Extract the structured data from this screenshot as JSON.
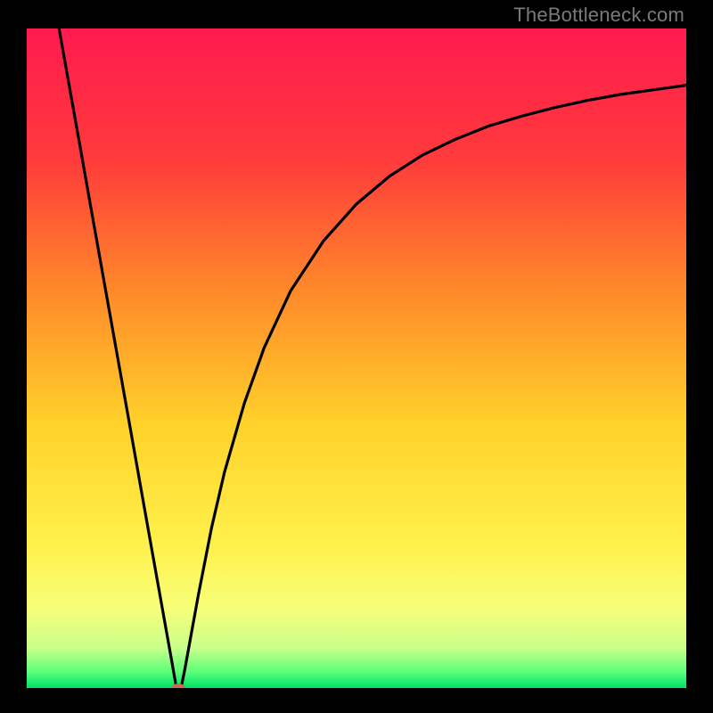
{
  "attribution": "TheBottleneck.com",
  "chart_data": {
    "type": "line",
    "title": "",
    "xlabel": "",
    "ylabel": "",
    "xlim": [
      0,
      100
    ],
    "ylim": [
      0,
      100
    ],
    "gradient_stops": [
      {
        "offset": 0.0,
        "color": "#ff1a4f"
      },
      {
        "offset": 0.2,
        "color": "#ff3b3b"
      },
      {
        "offset": 0.4,
        "color": "#ff8a2a"
      },
      {
        "offset": 0.6,
        "color": "#ffd22a"
      },
      {
        "offset": 0.78,
        "color": "#fff04a"
      },
      {
        "offset": 0.88,
        "color": "#f7ff7a"
      },
      {
        "offset": 0.94,
        "color": "#c8ff8a"
      },
      {
        "offset": 0.975,
        "color": "#5dff7a"
      },
      {
        "offset": 1.0,
        "color": "#00e06a"
      }
    ],
    "series": [
      {
        "name": "bottleneck-curve",
        "points": [
          {
            "x": 4.9,
            "y": 100.0
          },
          {
            "x": 6.0,
            "y": 93.8
          },
          {
            "x": 8.0,
            "y": 82.6
          },
          {
            "x": 10.0,
            "y": 71.3
          },
          {
            "x": 12.0,
            "y": 60.1
          },
          {
            "x": 14.0,
            "y": 48.9
          },
          {
            "x": 16.0,
            "y": 37.7
          },
          {
            "x": 18.0,
            "y": 26.4
          },
          {
            "x": 20.0,
            "y": 15.2
          },
          {
            "x": 22.0,
            "y": 4.0
          },
          {
            "x": 22.7,
            "y": 0.0
          },
          {
            "x": 23.4,
            "y": 0.0
          },
          {
            "x": 24.0,
            "y": 3.0
          },
          {
            "x": 25.0,
            "y": 8.5
          },
          {
            "x": 26.0,
            "y": 14.0
          },
          {
            "x": 28.0,
            "y": 24.2
          },
          {
            "x": 30.0,
            "y": 32.8
          },
          {
            "x": 33.0,
            "y": 43.2
          },
          {
            "x": 36.0,
            "y": 51.6
          },
          {
            "x": 40.0,
            "y": 60.2
          },
          {
            "x": 45.0,
            "y": 67.8
          },
          {
            "x": 50.0,
            "y": 73.4
          },
          {
            "x": 55.0,
            "y": 77.6
          },
          {
            "x": 60.0,
            "y": 80.8
          },
          {
            "x": 65.0,
            "y": 83.2
          },
          {
            "x": 70.0,
            "y": 85.2
          },
          {
            "x": 75.0,
            "y": 86.7
          },
          {
            "x": 80.0,
            "y": 88.0
          },
          {
            "x": 85.0,
            "y": 89.1
          },
          {
            "x": 90.0,
            "y": 90.0
          },
          {
            "x": 95.0,
            "y": 90.7
          },
          {
            "x": 100.0,
            "y": 91.4
          }
        ]
      }
    ],
    "marker": {
      "x": 23.0,
      "y": 0.0,
      "color": "#c96a5c",
      "rx": 8,
      "ry": 5
    }
  }
}
